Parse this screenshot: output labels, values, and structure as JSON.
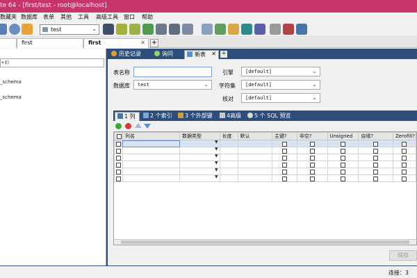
{
  "window": {
    "title": "te 64 - [first/test - root@localhost]"
  },
  "menu": [
    "数据库",
    "表单",
    "其他",
    "工具",
    "高级工具",
    "窗口",
    "帮助"
  ],
  "menu_partial": "数藏夹",
  "toolbar": {
    "db_select": "test"
  },
  "session_tabs": [
    "first",
    "first"
  ],
  "filter": {
    "text": "+‡)"
  },
  "tree": [
    "_schema",
    "_schema"
  ],
  "query_tabs": [
    {
      "label": "历史记录",
      "icon": "history-icon"
    },
    {
      "label": "询问",
      "icon": "query-icon"
    },
    {
      "label": "新表",
      "icon": "new-table-icon",
      "close": "✕"
    }
  ],
  "form": {
    "table_name_label": "表名称",
    "table_name_value": "",
    "database_label": "数据库",
    "database_value": "test",
    "engine_label": "引擎",
    "engine_value": "[default]",
    "charset_label": "字符集",
    "charset_value": "[default]",
    "collation_label": "核对",
    "collation_value": "[default]"
  },
  "sub_tabs": [
    "1 列",
    "2 个索引",
    "3 个外部键",
    "4高级",
    "5 个 SQL 预览"
  ],
  "grid": {
    "headers": [
      "列名",
      "数据类型",
      "长度",
      "默认",
      "主键?",
      "非空?",
      "Unsigned",
      "自增?",
      "Zerofill?"
    ],
    "row_count": 6
  },
  "save_button": "保存",
  "status": {
    "connections": "连接：3"
  },
  "colors": {
    "title_bg": "#c8346c",
    "pane_navy": "#2d4d7a",
    "accent_green": "#3aa83a",
    "accent_red": "#d33c3c",
    "accent_blue": "#5a8fd6"
  }
}
